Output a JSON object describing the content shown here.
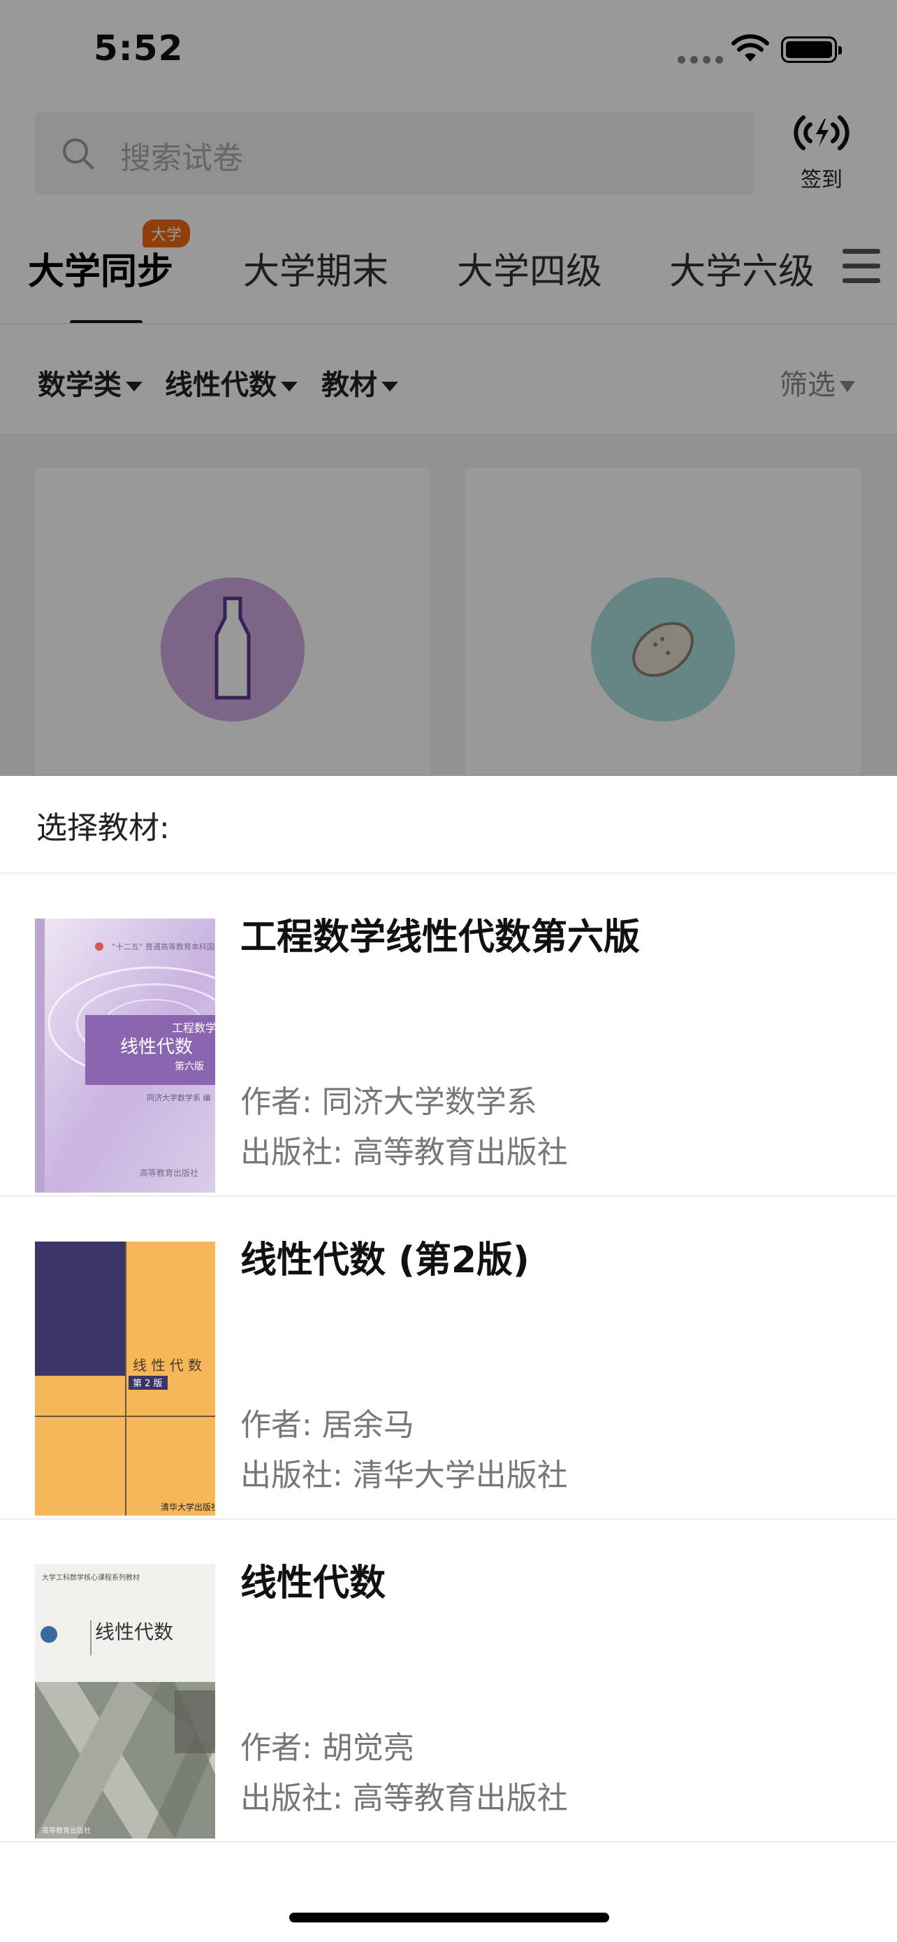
{
  "status_bar": {
    "time": "5:52"
  },
  "search": {
    "placeholder": "搜索试卷"
  },
  "checkin": {
    "label": "签到"
  },
  "tabs": [
    {
      "label": "大学同步",
      "active": true,
      "badge": "大学"
    },
    {
      "label": "大学期末"
    },
    {
      "label": "大学四级"
    },
    {
      "label": "大学六级"
    }
  ],
  "filters": {
    "category": "数学类",
    "subject": "线性代数",
    "type": "教材",
    "screen": "筛选"
  },
  "sheet": {
    "title": "选择教材:",
    "books": [
      {
        "title": "工程数学线性代数第六版",
        "author": "作者: 同济大学数学系",
        "publisher": "出版社: 高等教育出版社",
        "cover_title": "线性代数",
        "cover_series": "工程数学",
        "cover_edition": "第六版"
      },
      {
        "title": "线性代数 (第2版)",
        "author": "作者: 居余马",
        "publisher": "出版社: 清华大学出版社",
        "cover_title": "线 性 代 数",
        "cover_edition": "第 2 版",
        "cover_press": "清华大学出版社"
      },
      {
        "title": "线性代数",
        "author": "作者: 胡觉亮",
        "publisher": "出版社: 高等教育出版社",
        "cover_title": "线性代数"
      }
    ]
  },
  "colors": {
    "badge": "#f06a14",
    "overlay": "rgba(0,0,0,0.4)",
    "card_circle_1": "#cfa8df",
    "card_circle_2": "#a8e0de"
  }
}
